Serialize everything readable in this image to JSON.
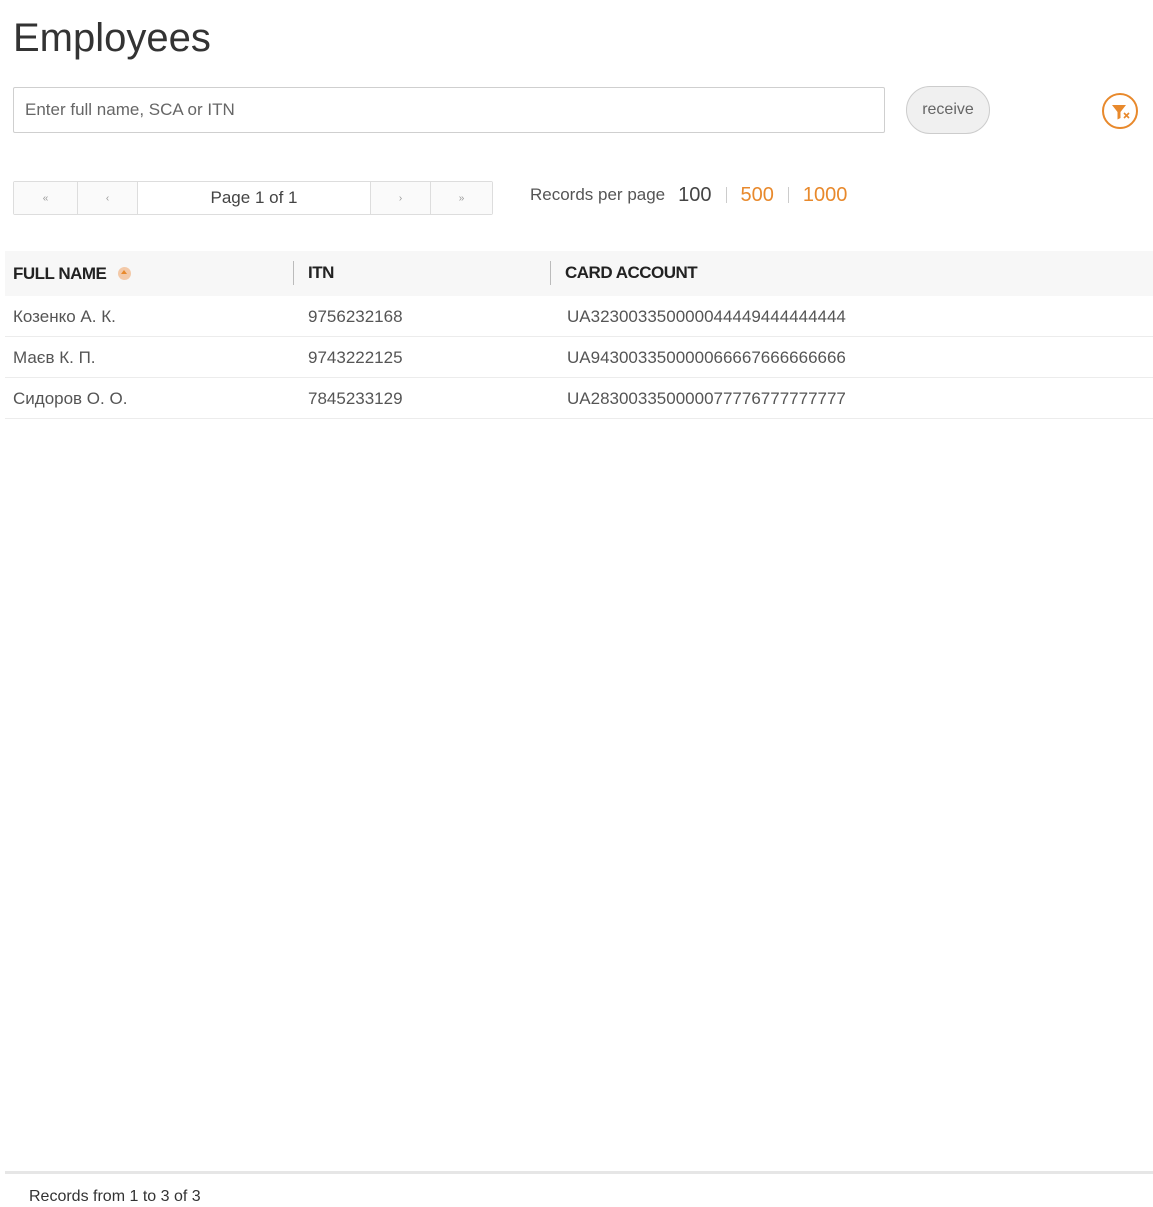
{
  "page": {
    "title": "Employees"
  },
  "search": {
    "placeholder": "Enter full name, SCA or ITN",
    "value": "",
    "receive_label": "receive"
  },
  "icons": {
    "filter_clear": "filter-clear-icon",
    "sort": "sort-ascending-icon"
  },
  "colors": {
    "accent": "#e8892c",
    "header_bg": "#f7f7f7"
  },
  "pager": {
    "first": "«",
    "prev": "‹",
    "info": "Page 1 of 1",
    "next": "›",
    "last": "»"
  },
  "per_page": {
    "label": "Records per page",
    "options": [
      "100",
      "500",
      "1000"
    ],
    "selected": "100"
  },
  "table": {
    "columns": [
      "FULL NAME",
      "ITN",
      "CARD ACCOUNT"
    ],
    "sorted_column": "FULL NAME",
    "rows": [
      [
        "Козенко А. К.",
        "9756232168",
        "UA323003350000044449444444444"
      ],
      [
        "Маєв К. П.",
        "9743222125",
        "UA943003350000066667666666666"
      ],
      [
        "Сидоров О. О.",
        "7845233129",
        "UA283003350000077776777777777"
      ]
    ]
  },
  "footer": {
    "summary": "Records from 1 to 3 of 3"
  }
}
